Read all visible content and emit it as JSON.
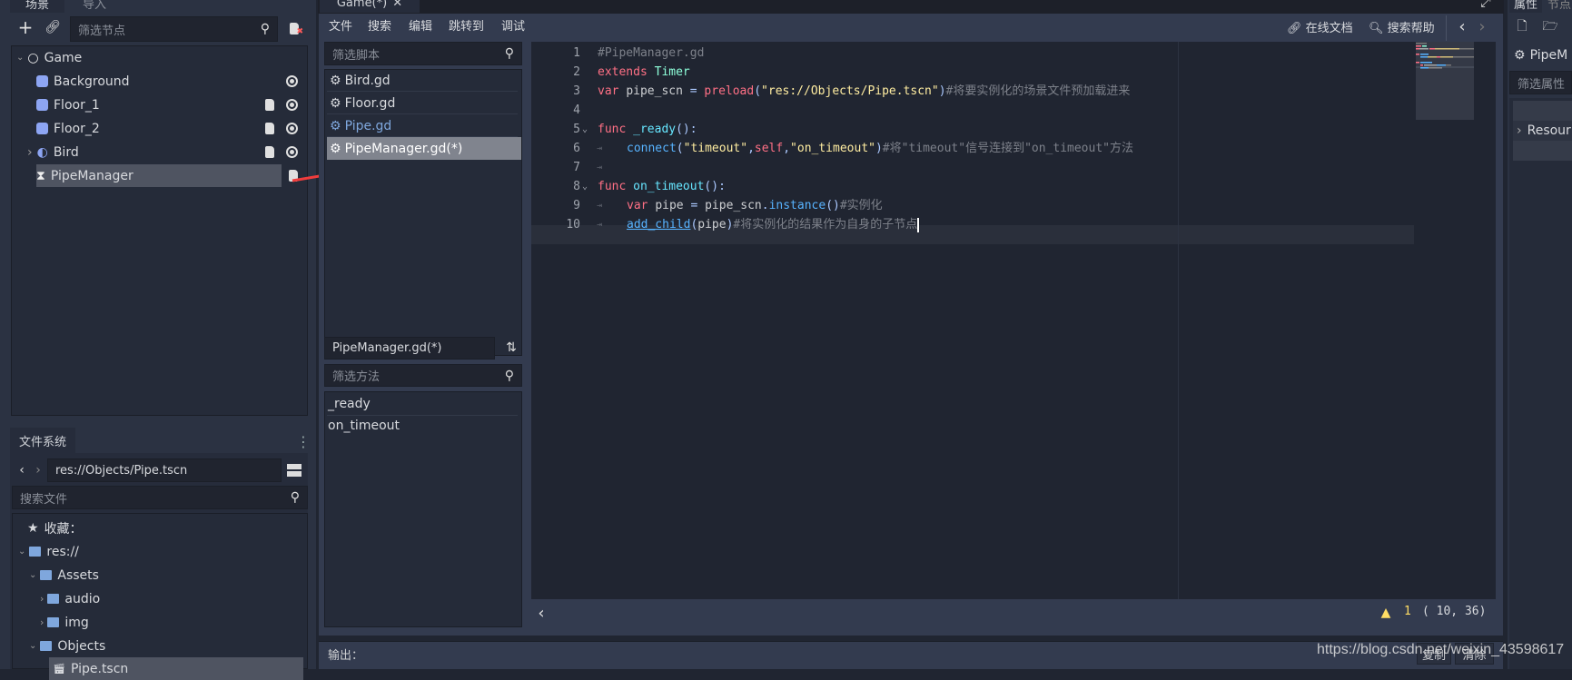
{
  "scene_dock": {
    "tabs": [
      "场景",
      "导入"
    ],
    "filter_placeholder": "筛选节点",
    "nodes": [
      {
        "label": "Game",
        "icon": "node2d-icon"
      },
      {
        "label": "Background",
        "icon": "sprite-icon",
        "visible": true
      },
      {
        "label": "Floor_1",
        "icon": "sprite-icon",
        "script": true,
        "visible": true
      },
      {
        "label": "Floor_2",
        "icon": "sprite-icon",
        "script": true,
        "visible": true
      },
      {
        "label": "Bird",
        "icon": "rigidbody-icon",
        "script": true,
        "visible": true
      },
      {
        "label": "PipeManager",
        "icon": "timer-icon",
        "script": true,
        "selected": true
      }
    ]
  },
  "filesystem": {
    "tab": "文件系统",
    "path": "res://Objects/Pipe.tscn",
    "search_placeholder": "搜索文件",
    "items": [
      "收藏：",
      "res://",
      "Assets",
      "audio",
      "img",
      "Objects",
      "Pipe.tscn"
    ]
  },
  "script_editor": {
    "scene_tab": "Game(*)",
    "menu": [
      "文件",
      "搜索",
      "编辑",
      "跳转到",
      "调试"
    ],
    "online_docs": "在线文档",
    "search_help": "搜索帮助",
    "filter_scripts_placeholder": "筛选脚本",
    "scripts": [
      {
        "label": "Bird.gd"
      },
      {
        "label": "Floor.gd"
      },
      {
        "label": "Pipe.gd",
        "highlight": true
      },
      {
        "label": "PipeManager.gd(*)",
        "selected": true
      }
    ],
    "current_script": "PipeManager.gd(*)",
    "filter_methods_placeholder": "筛选方法",
    "methods": [
      "_ready",
      "on_timeout"
    ],
    "code_lines": [
      [
        {
          "t": "#PipeManager.gd",
          "c": "cm"
        }
      ],
      [
        {
          "t": "extends ",
          "c": "kw"
        },
        {
          "t": "Timer",
          "c": "ty"
        }
      ],
      [
        {
          "t": "var ",
          "c": "kw"
        },
        {
          "t": "pipe_scn ",
          "c": "id"
        },
        {
          "t": "= ",
          "c": "sym"
        },
        {
          "t": "preload",
          "c": "kw"
        },
        {
          "t": "(",
          "c": "sym"
        },
        {
          "t": "\"res://Objects/Pipe.tscn\"",
          "c": "str"
        },
        {
          "t": ")",
          "c": "sym"
        },
        {
          "t": "#将要实例化的场景文件预加载进来",
          "c": "cm"
        }
      ],
      [],
      [
        {
          "t": "func ",
          "c": "kw"
        },
        {
          "t": "_ready",
          "c": "fd"
        },
        {
          "t": "():",
          "c": "sym"
        }
      ],
      [
        {
          "t": "connect",
          "c": "fn"
        },
        {
          "t": "(",
          "c": "sym"
        },
        {
          "t": "\"timeout\"",
          "c": "str"
        },
        {
          "t": ",",
          "c": "sym"
        },
        {
          "t": "self",
          "c": "kw"
        },
        {
          "t": ",",
          "c": "sym"
        },
        {
          "t": "\"on_timeout\"",
          "c": "str"
        },
        {
          "t": ")",
          "c": "sym"
        },
        {
          "t": "#将\"timeout\"信号连接到\"on_timeout\"方法",
          "c": "cm"
        }
      ],
      [],
      [
        {
          "t": "func ",
          "c": "kw"
        },
        {
          "t": "on_timeout",
          "c": "fd"
        },
        {
          "t": "():",
          "c": "sym"
        }
      ],
      [
        {
          "t": "var ",
          "c": "kw"
        },
        {
          "t": "pipe ",
          "c": "id"
        },
        {
          "t": "= ",
          "c": "sym"
        },
        {
          "t": "pipe_scn",
          "c": "id"
        },
        {
          "t": ".",
          "c": "sym"
        },
        {
          "t": "instance",
          "c": "fn"
        },
        {
          "t": "()",
          "c": "sym"
        },
        {
          "t": "#实例化",
          "c": "cm"
        }
      ],
      [
        {
          "t": "add_child",
          "c": "mc"
        },
        {
          "t": "(",
          "c": "sym"
        },
        {
          "t": "pipe",
          "c": "id"
        },
        {
          "t": ")",
          "c": "sym"
        },
        {
          "t": "#将实例化的结果作为自身的子节点",
          "c": "cm"
        }
      ]
    ],
    "indented_lines": [
      6,
      7,
      9,
      10
    ],
    "folded_lines": [
      5,
      8
    ],
    "current_line": 10,
    "warnings": "1",
    "cursor": "( 10, 36)"
  },
  "output": {
    "label": "输出：",
    "copy": "复制",
    "clear": "清除"
  },
  "inspector": {
    "tabs": [
      "属性",
      "节点"
    ],
    "object": "PipeM",
    "filter_placeholder": "筛选属性",
    "section": "Resour"
  },
  "watermark": "https://blog.csdn.net/weixin_43598617",
  "colors": {
    "annotation_arrow": "#f03c3c",
    "warning": "#ffdd65",
    "accent": "#6a9ad9"
  }
}
